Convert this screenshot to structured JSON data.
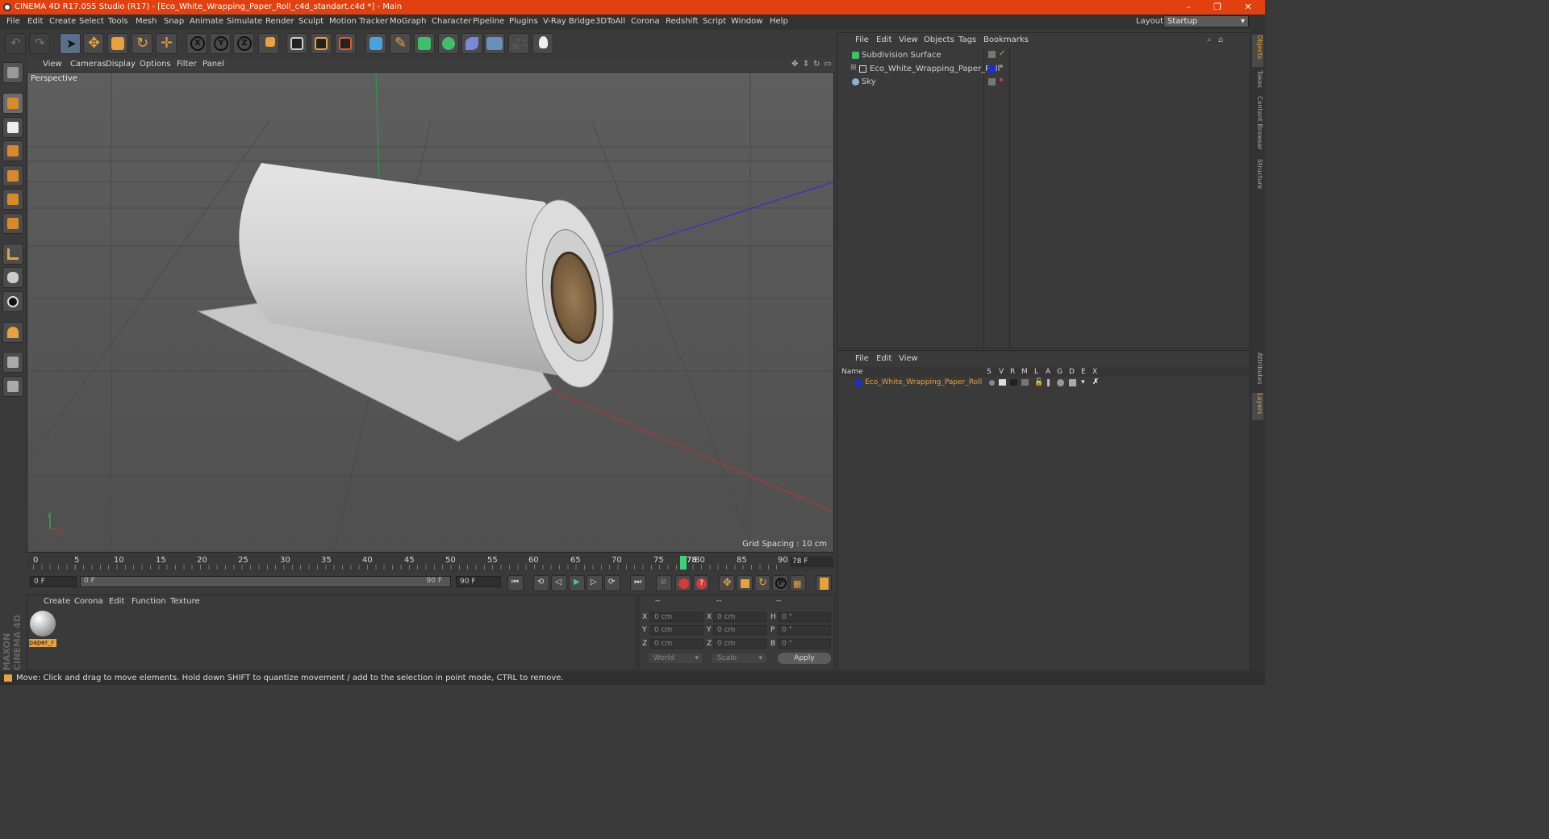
{
  "window": {
    "title": "CINEMA 4D R17.055 Studio (R17) - [Eco_White_Wrapping_Paper_Roll_c4d_standart.c4d *] - Main",
    "minimize": "–",
    "restore": "❐",
    "close": "✕"
  },
  "menu": [
    "File",
    "Edit",
    "Create",
    "Select",
    "Tools",
    "Mesh",
    "Snap",
    "Animate",
    "Simulate",
    "Render",
    "Sculpt",
    "Motion Tracker",
    "MoGraph",
    "Character",
    "Pipeline",
    "Plugins",
    "V-Ray Bridge",
    "3DToAll",
    "Corona",
    "Redshift",
    "Script",
    "Window",
    "Help"
  ],
  "layout": {
    "label": "Layout:",
    "value": "Startup"
  },
  "viewport": {
    "menu": [
      "View",
      "Cameras",
      "Display",
      "Options",
      "Filter",
      "Panel"
    ],
    "camera_label": "Perspective",
    "grid_spacing": "Grid Spacing : 10 cm"
  },
  "timeline": {
    "ticks": [
      "0",
      "5",
      "10",
      "15",
      "20",
      "25",
      "30",
      "35",
      "40",
      "45",
      "50",
      "55",
      "60",
      "65",
      "70",
      "75",
      "80",
      "85",
      "90"
    ],
    "current_frame_marker": "78",
    "current_frame_field": "78 F",
    "start_field": "0 F",
    "range_start": "0 F",
    "range_end": "90 F",
    "end_field": "90 F"
  },
  "material_panel": {
    "menu": [
      "Create",
      "Corona",
      "Edit",
      "Function",
      "Texture"
    ],
    "material_name": "paper_r"
  },
  "coords": {
    "headers": [
      "--",
      "--",
      "--"
    ],
    "rows": [
      {
        "a": "X",
        "av": "0 cm",
        "b": "X",
        "bv": "0 cm",
        "c": "H",
        "cv": "0 °"
      },
      {
        "a": "Y",
        "av": "0 cm",
        "b": "Y",
        "bv": "0 cm",
        "c": "P",
        "cv": "0 °"
      },
      {
        "a": "Z",
        "av": "0 cm",
        "b": "Z",
        "bv": "0 cm",
        "c": "B",
        "cv": "0 °"
      }
    ],
    "world": "World",
    "scale": "Scale",
    "apply": "Apply"
  },
  "objects_panel": {
    "menu": [
      "File",
      "Edit",
      "View",
      "Objects",
      "Tags",
      "Bookmarks"
    ],
    "items": [
      {
        "name": "Subdivision Surface"
      },
      {
        "name": "Eco_White_Wrapping_Paper_Roll"
      },
      {
        "name": "Sky"
      }
    ]
  },
  "attributes_panel": {
    "menu": [
      "File",
      "Edit",
      "View"
    ],
    "columns": [
      "Name",
      "S",
      "V",
      "R",
      "M",
      "L",
      "A",
      "G",
      "D",
      "E",
      "X"
    ],
    "layer_name": "Eco_White_Wrapping_Paper_Roll"
  },
  "side_tabs": [
    "Objects",
    "Takes",
    "Content Browser",
    "Structure",
    "Attributes",
    "Layers"
  ],
  "status": "Move: Click and drag to move elements. Hold down SHIFT to quantize movement / add to the selection in point mode, CTRL to remove.",
  "brand": "MAXON CINEMA 4D",
  "colors": {
    "title_bar": "#e2400e",
    "accent_orange": "#e8a23a",
    "layer_blue": "#1a2fd6",
    "playhead_green": "#3fd07a"
  }
}
